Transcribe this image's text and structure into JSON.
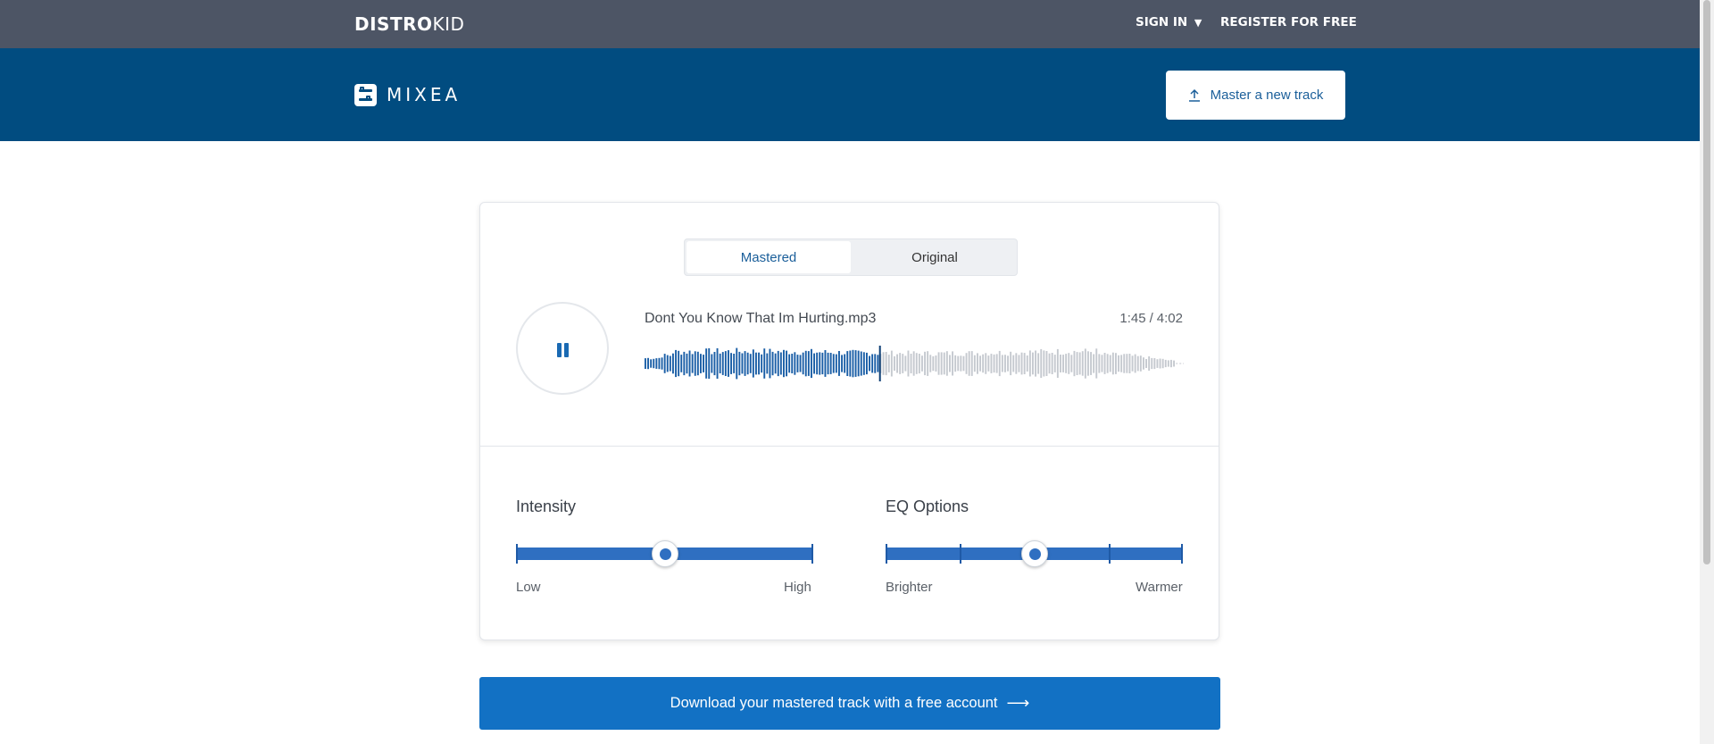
{
  "header": {
    "brand": {
      "bold": "DISTRO",
      "light": "KID"
    },
    "sign_in": "SIGN IN",
    "register": "REGISTER FOR FREE"
  },
  "mixea": {
    "logo_text": "MIXEA",
    "master_button": "Master a new track"
  },
  "player": {
    "tabs": [
      {
        "label": "Mastered",
        "selected": true
      },
      {
        "label": "Original",
        "selected": false
      }
    ],
    "state": "playing",
    "track_name": "Dont You Know That Im Hurting.mp3",
    "current_time": "1:45",
    "time_separator": "/",
    "duration": "4:02",
    "played_fraction": 0.435
  },
  "controls": {
    "intensity": {
      "title": "Intensity",
      "low_label": "Low",
      "high_label": "High",
      "value_fraction": 0.5
    },
    "eq": {
      "title": "EQ Options",
      "low_label": "Brighter",
      "high_label": "Warmer",
      "steps": 5,
      "value_index": 2
    }
  },
  "download_button": "Download your mastered track with a free account",
  "icons": {
    "dropdown": "caret-down-icon",
    "upload": "upload-icon",
    "pause": "pause-icon",
    "arrow": "arrow-right-icon"
  },
  "colors": {
    "top_bar": "#4d5565",
    "mixea_bar": "#014c80",
    "accent": "#1271c4",
    "played_wave": "#1a5ea6",
    "unplayed_wave": "#c5c9cf"
  }
}
